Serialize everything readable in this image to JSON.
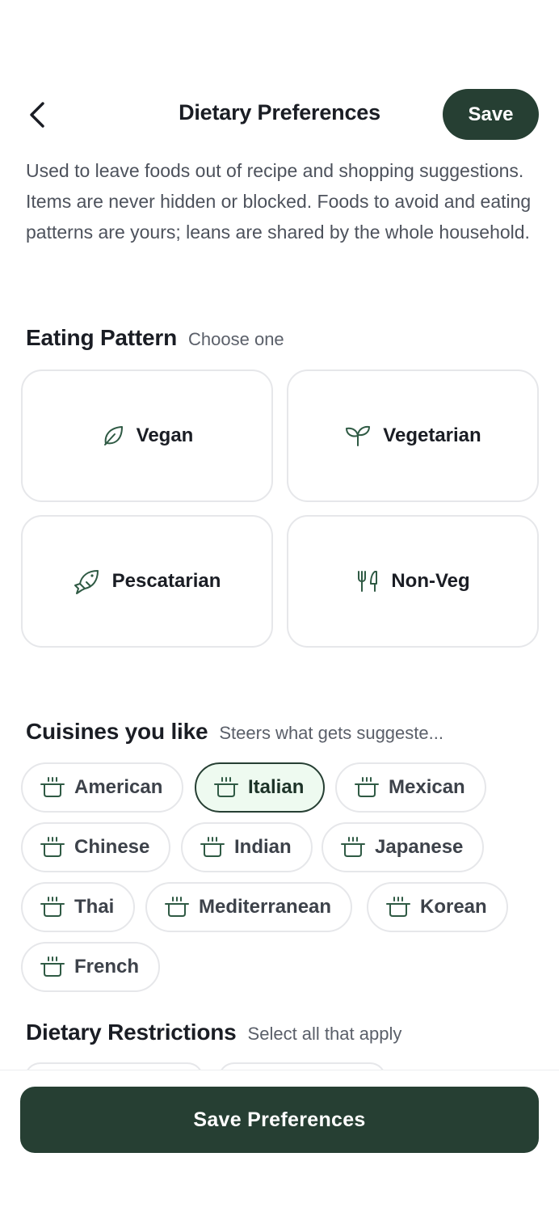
{
  "header": {
    "title": "Dietary Preferences",
    "save_label": "Save",
    "back_icon": "chevron-left-icon"
  },
  "intro": "Used to leave foods out of recipe and shopping suggestions. Items are never hidden or blocked. Foods to avoid and eating patterns are yours; leans are shared by the whole household.",
  "eating_pattern": {
    "title": "Eating Pattern",
    "subtitle": "Choose one",
    "options": [
      {
        "label": "Vegan",
        "icon": "leaf-icon"
      },
      {
        "label": "Vegetarian",
        "icon": "sprout-icon"
      },
      {
        "label": "Pescatarian",
        "icon": "fish-icon"
      },
      {
        "label": "Non-Veg",
        "icon": "utensils-icon"
      }
    ]
  },
  "cuisines": {
    "title": "Cuisines you like",
    "subtitle": "Steers what gets suggeste...",
    "icon": "cooking-pot-icon",
    "selected": "Italian",
    "items": [
      "American",
      "Italian",
      "Mexican",
      "Chinese",
      "Indian",
      "Japanese",
      "Thai",
      "Mediterranean",
      "Korean",
      "French"
    ]
  },
  "restrictions": {
    "title": "Dietary Restrictions",
    "subtitle": "Select all that apply"
  },
  "footer": {
    "save_label": "Save Preferences"
  },
  "colors": {
    "primary": "#263f33",
    "selected_bg": "#eefaf0",
    "border": "#e6e7ea",
    "icon": "#2f5a44"
  }
}
